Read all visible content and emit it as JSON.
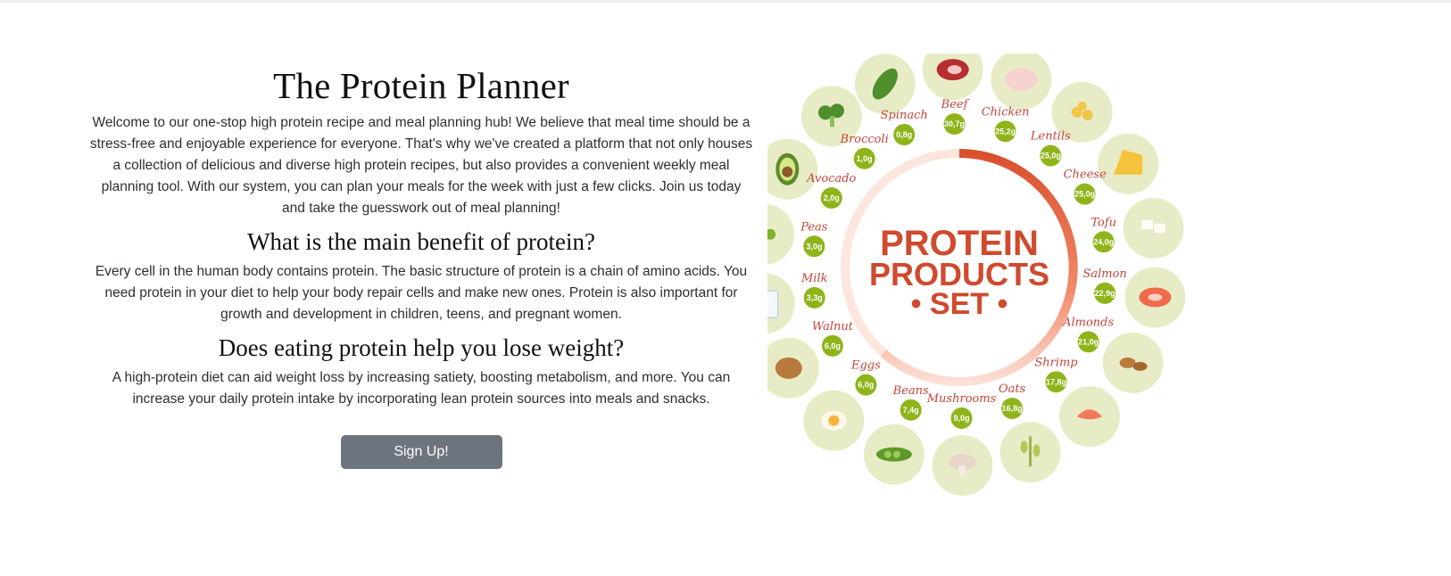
{
  "main": {
    "title": "The Protein Planner",
    "intro": "Welcome to our one-stop high protein recipe and meal planning hub! We believe that meal time should be a stress-free and enjoyable experience for everyone. That's why we've created a platform that not only houses a collection of delicious and diverse high protein recipes, but also provides a convenient weekly meal planning tool. With our system, you can plan your meals for the week with just a few clicks. Join us today and take the guesswork out of meal planning!",
    "heading_benefit": "What is the main benefit of protein?",
    "benefit_text": "Every cell in the human body contains protein. The basic structure of protein is a chain of amino acids. You need protein in your diet to help your body repair cells and make new ones. Protein is also important for growth and development in children, teens, and pregnant women.",
    "heading_weight": "Does eating protein help you lose weight?",
    "weight_text": "A high-protein diet can aid weight loss by increasing satiety, boosting metabolism, and more. You can increase your daily protein intake by incorporating lean protein sources into meals and snacks.",
    "signup_label": "Sign Up!"
  },
  "graphic": {
    "center_line1": "PROTEIN",
    "center_line2": "PRODUCTS",
    "center_line3": "• SET •",
    "foods": [
      {
        "name": "Spinach",
        "value": "0,8g",
        "icon": "spinach-leaf"
      },
      {
        "name": "Beef",
        "value": "30,7g",
        "icon": "beef-steak"
      },
      {
        "name": "Chicken",
        "value": "25,2g",
        "icon": "chicken"
      },
      {
        "name": "Lentils",
        "value": "25,0g",
        "icon": "lentils"
      },
      {
        "name": "Cheese",
        "value": "25,0g",
        "icon": "cheese"
      },
      {
        "name": "Tofu",
        "value": "24,0g",
        "icon": "tofu"
      },
      {
        "name": "Salmon",
        "value": "22,9g",
        "icon": "salmon"
      },
      {
        "name": "Almonds",
        "value": "21,0g",
        "icon": "almonds"
      },
      {
        "name": "Shrimp",
        "value": "17,8g",
        "icon": "shrimp"
      },
      {
        "name": "Oats",
        "value": "16,8g",
        "icon": "oats"
      },
      {
        "name": "Mushrooms",
        "value": "9,0g",
        "icon": "mushrooms"
      },
      {
        "name": "Beans",
        "value": "7,4g",
        "icon": "beans"
      },
      {
        "name": "Eggs",
        "value": "6,0g",
        "icon": "eggs"
      },
      {
        "name": "Walnut",
        "value": "6,0g",
        "icon": "walnut"
      },
      {
        "name": "Milk",
        "value": "3,3g",
        "icon": "milk-bottles"
      },
      {
        "name": "Peas",
        "value": "3,0g",
        "icon": "peas"
      },
      {
        "name": "Avocado",
        "value": "2,0g",
        "icon": "avocado"
      },
      {
        "name": "Broccoli",
        "value": "1,0g",
        "icon": "broccoli"
      }
    ],
    "colors": {
      "label": "#c2453a",
      "badge": "#8fb41a",
      "blob": "#e8ecc6",
      "ring": "#e2572f"
    }
  }
}
